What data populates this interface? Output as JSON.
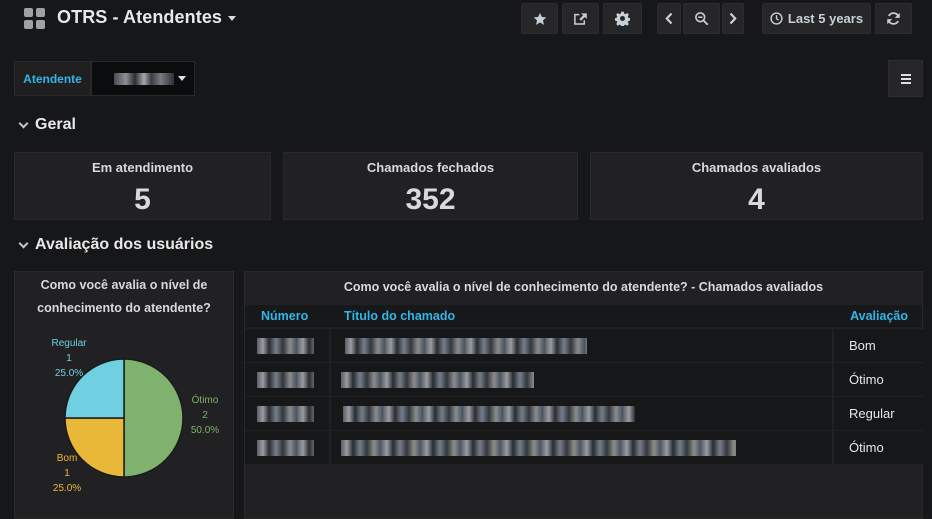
{
  "navbar": {
    "title": "OTRS - Atendentes",
    "time_range": "Last 5 years"
  },
  "variables": {
    "atendente_label": "Atendente"
  },
  "rows": {
    "geral": "Geral",
    "avaliacao": "Avaliação dos usuários"
  },
  "stats": [
    {
      "title": "Em atendimento",
      "value": "5"
    },
    {
      "title": "Chamados fechados",
      "value": "352"
    },
    {
      "title": "Chamados avaliados",
      "value": "4"
    }
  ],
  "pie": {
    "title_line1": "Como você avalia o nível de",
    "title_line2": "conhecimento do atendente?",
    "slices": [
      {
        "name": "Ótimo",
        "count": "2",
        "pct": "50.0%",
        "value": 2,
        "color": "#7eb26d"
      },
      {
        "name": "Bom",
        "count": "1",
        "pct": "25.0%",
        "value": 1,
        "color": "#eab839"
      },
      {
        "name": "Regular",
        "count": "1",
        "pct": "25.0%",
        "value": 1,
        "color": "#6ed0e0"
      }
    ]
  },
  "table": {
    "title": "Como você avalia o nível de conhecimento do atendente? - Chamados avaliados",
    "columns": [
      "Número",
      "Título do chamado",
      "Avaliação"
    ],
    "rows": [
      {
        "avaliacao": "Bom"
      },
      {
        "avaliacao": "Ótimo"
      },
      {
        "avaliacao": "Regular"
      },
      {
        "avaliacao": "Ótimo"
      }
    ]
  },
  "icons": {
    "grid": "grid-icon",
    "star": "star-icon",
    "share": "share-icon",
    "settings": "gear-icon",
    "prev": "chevron-left-icon",
    "zoom": "zoom-out-icon",
    "next": "chevron-right-icon",
    "clock": "clock-icon",
    "refresh": "refresh-icon",
    "menu": "hamburger-icon"
  }
}
